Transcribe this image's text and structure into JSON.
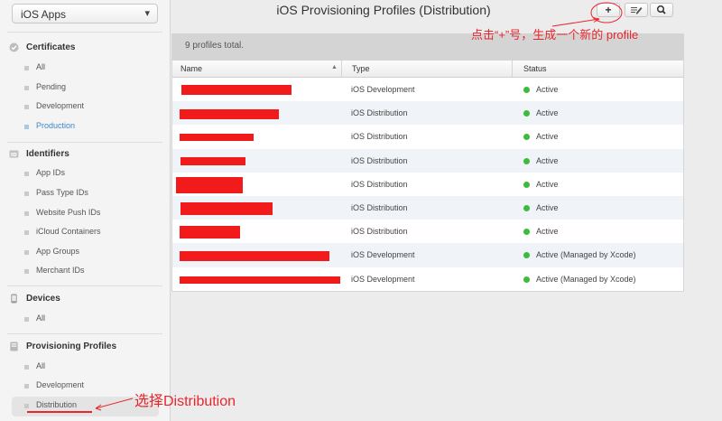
{
  "sidebar": {
    "app_select": "iOS Apps",
    "sections": [
      {
        "title": "Certificates",
        "icon": "certificate-icon",
        "items": [
          "All",
          "Pending",
          "Development",
          "Production"
        ]
      },
      {
        "title": "Identifiers",
        "icon": "id-icon",
        "items": [
          "App IDs",
          "Pass Type IDs",
          "Website Push IDs",
          "iCloud Containers",
          "App Groups",
          "Merchant IDs"
        ]
      },
      {
        "title": "Devices",
        "icon": "device-icon",
        "items": [
          "All"
        ]
      },
      {
        "title": "Provisioning Profiles",
        "icon": "profile-icon",
        "items": [
          "All",
          "Development",
          "Distribution"
        ]
      }
    ]
  },
  "header": {
    "title": "iOS Provisioning Profiles (Distribution)",
    "add_label": "+",
    "edit_icon": "edit-icon",
    "search_icon": "search-icon"
  },
  "summary": "9 profiles total.",
  "table": {
    "columns": [
      "Name",
      "Type",
      "Status"
    ],
    "rows": [
      {
        "type": "iOS Development",
        "status": "Active"
      },
      {
        "type": "iOS Distribution",
        "status": "Active"
      },
      {
        "type": "iOS Distribution",
        "status": "Active"
      },
      {
        "type": "iOS Distribution",
        "status": "Active"
      },
      {
        "type": "iOS Distribution",
        "status": "Active"
      },
      {
        "type": "iOS Distribution",
        "status": "Active"
      },
      {
        "type": "iOS Distribution",
        "status": "Active"
      },
      {
        "type": "iOS Development",
        "status": "Active (Managed by Xcode)"
      },
      {
        "type": "iOS Development",
        "status": "Active (Managed by Xcode)"
      }
    ]
  },
  "annotations": {
    "add_hint": "点击“+”号，生成一个新的 profile",
    "select_hint": "选择Distribution"
  },
  "colors": {
    "annotation": "#e8262c",
    "active_link": "#3b88c9",
    "status_active": "#3dbb3d"
  }
}
